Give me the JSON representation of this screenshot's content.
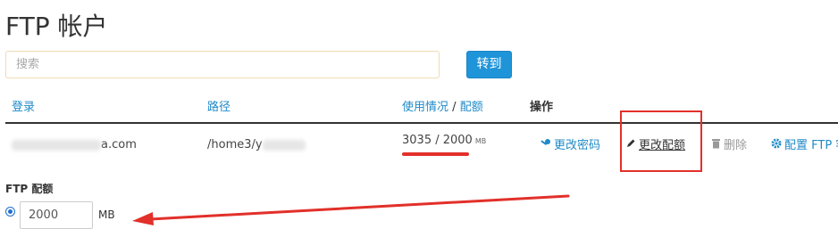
{
  "page": {
    "title": "FTP 帐户"
  },
  "search": {
    "placeholder": "搜索",
    "go_label": "转到"
  },
  "table": {
    "headers": {
      "login": "登录",
      "path": "路径",
      "usage": "使用情况",
      "separator": "/",
      "quota": "配额",
      "actions": "操作"
    },
    "row": {
      "login_suffix": "a.com",
      "path_prefix": "/home3/y",
      "usage_value": "3035 / 2000",
      "usage_unit": "MB",
      "actions": {
        "change_password": "更改密码",
        "change_quota": "更改配额",
        "delete": "删除",
        "configure": "配置 FTP 客"
      }
    }
  },
  "quota_editor": {
    "label": "FTP 配额",
    "value": "2000",
    "unit": "MB"
  },
  "colors": {
    "link": "#1f8ac7",
    "button": "#1f94d9",
    "annotation_red": "#e2302a"
  },
  "icons": {
    "change_password": "key-icon",
    "change_quota": "pencil-icon",
    "delete": "trash-icon",
    "configure": "gear-icon"
  }
}
